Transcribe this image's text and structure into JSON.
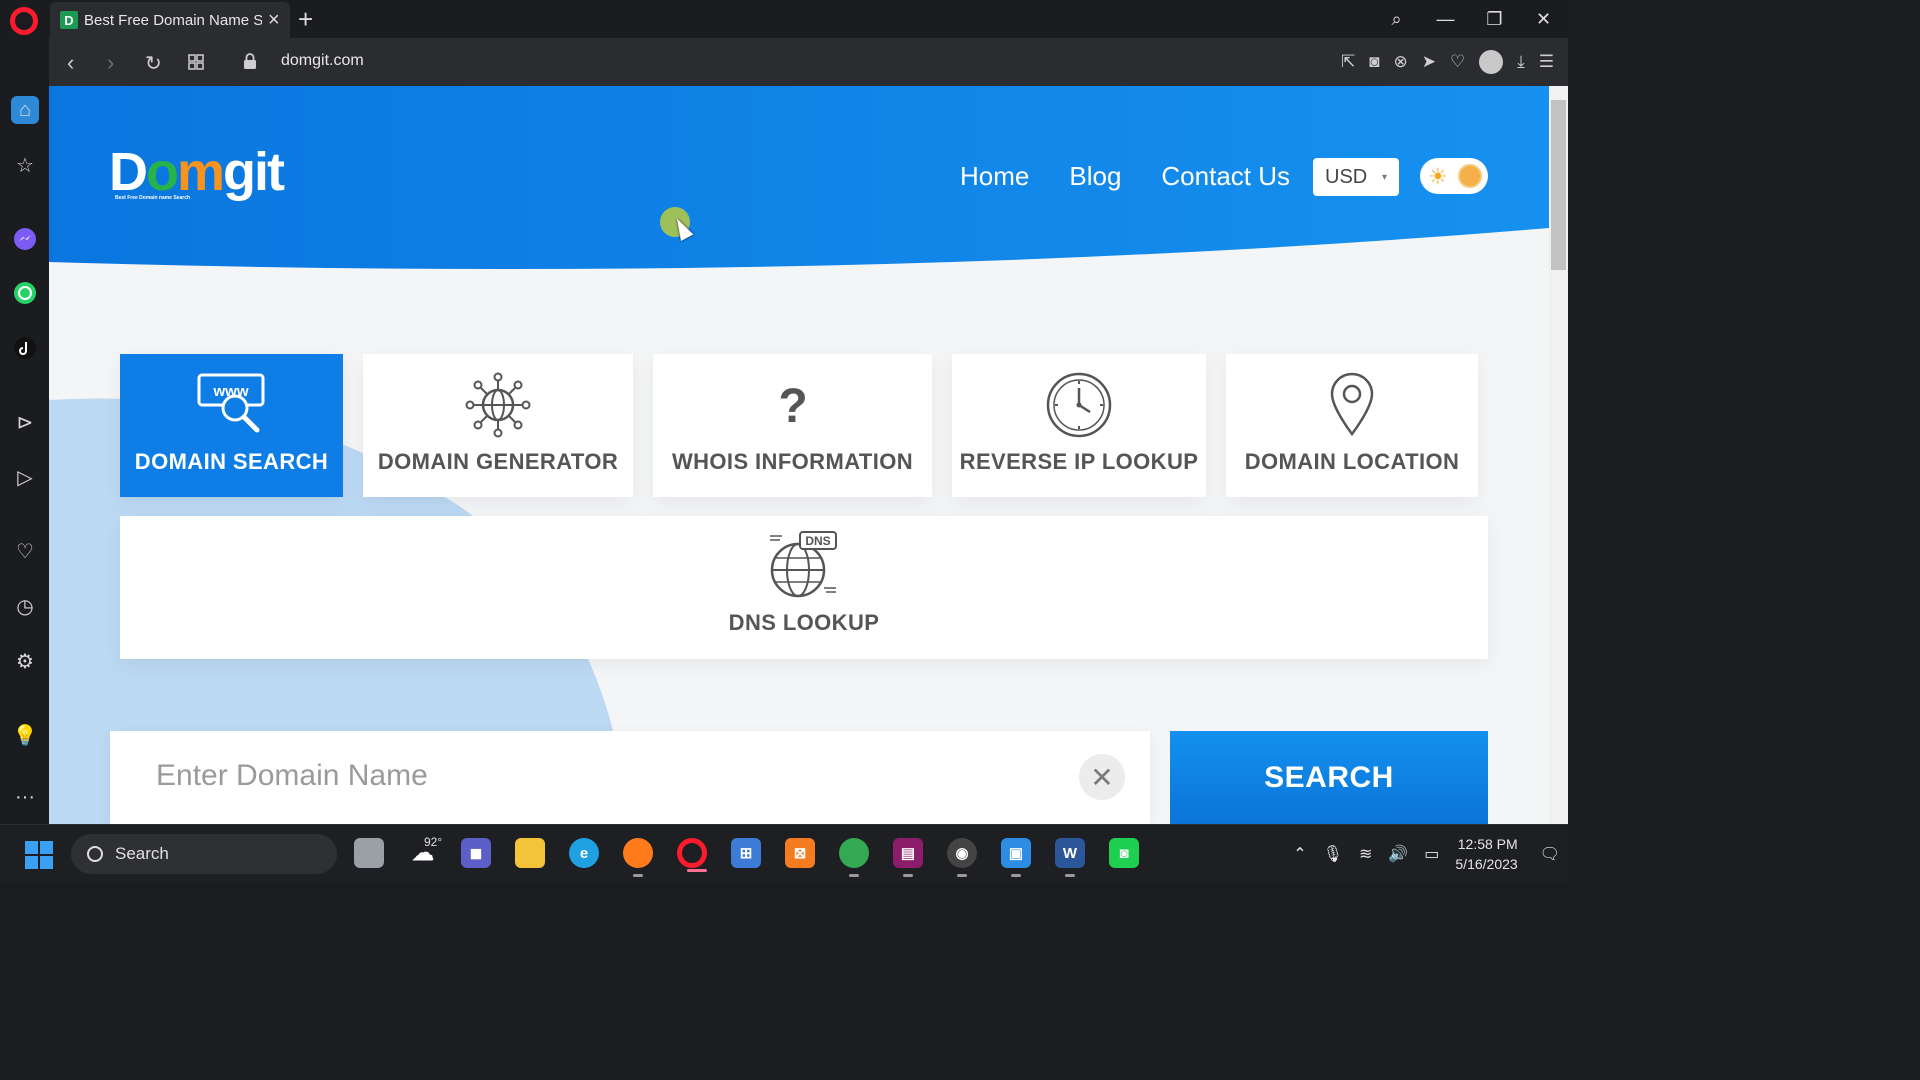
{
  "browser": {
    "tab": {
      "title": "Best Free Domain Name Se",
      "favicon_letter": "D"
    },
    "url": "domgit.com"
  },
  "site": {
    "logo": {
      "part1": "D",
      "part2": "o",
      "part3": "m",
      "part4": "git",
      "tagline": "Best Free Domain name Search"
    },
    "nav": [
      "Home",
      "Blog",
      "Contact Us"
    ],
    "currency": "USD",
    "tools": [
      {
        "label": "DOMAIN SEARCH",
        "icon": "www-search-icon",
        "active": true
      },
      {
        "label": "DOMAIN GENERATOR",
        "icon": "globe-network-icon",
        "active": false
      },
      {
        "label": "WHOIS INFORMATION",
        "icon": "question-mark-icon",
        "active": false
      },
      {
        "label": "REVERSE IP LOOKUP",
        "icon": "clock-icon",
        "active": false
      },
      {
        "label": "DOMAIN LOCATION",
        "icon": "map-pin-icon",
        "active": false
      }
    ],
    "dns_tool": {
      "label": "DNS LOOKUP",
      "icon_text": "DNS"
    },
    "search": {
      "placeholder": "Enter Domain Name",
      "button": "SEARCH"
    }
  },
  "taskbar": {
    "search_label": "Search",
    "weather_temp": "92°",
    "time": "12:58 PM",
    "date": "5/16/2023"
  },
  "colors": {
    "brand_blue": "#0e7de6",
    "page_bg": "#f4f5f7"
  }
}
